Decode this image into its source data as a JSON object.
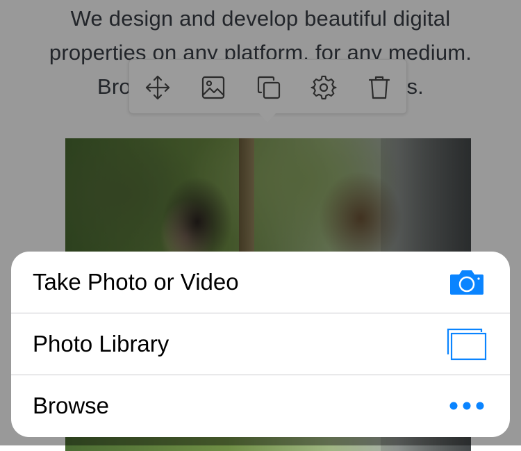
{
  "page": {
    "intro_lines": [
      "We design and develop beautiful digital",
      "properties on any platform, for any medium.",
      "Browse our featured experiences."
    ]
  },
  "toolbar": {
    "buttons": [
      {
        "name": "move-icon"
      },
      {
        "name": "image-icon"
      },
      {
        "name": "duplicate-icon"
      },
      {
        "name": "gear-icon"
      },
      {
        "name": "trash-icon"
      }
    ],
    "icon_color": "#2b2b2b",
    "background": "#9b9b9b"
  },
  "action_sheet": {
    "items": [
      {
        "label": "Take Photo or Video",
        "icon": "camera-icon"
      },
      {
        "label": "Photo Library",
        "icon": "photo-library-icon"
      },
      {
        "label": "Browse",
        "icon": "more-icon"
      }
    ],
    "accent_color": "#0a84ff"
  },
  "colors": {
    "overlay": "rgba(0,0,0,0.4)",
    "sheet_background": "#ffffff",
    "separator": "#c9c9cd"
  }
}
